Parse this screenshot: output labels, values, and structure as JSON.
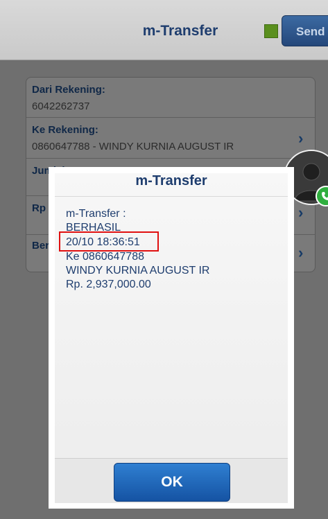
{
  "header": {
    "title": "m-Transfer",
    "send_label": "Send"
  },
  "form": {
    "dari_label": "Dari Rekening:",
    "dari_value": "6042262737",
    "ke_label": "Ke Rekening:",
    "ke_value": "0860647788 - WINDY KURNIA AUGUST IR",
    "jumlah_label": "Jumlah U",
    "rp_label": "Rp",
    "ber_label": "Ber"
  },
  "dialog": {
    "title": "m-Transfer",
    "lines": [
      "m-Transfer :",
      "BERHASIL",
      "20/10 18:36:51",
      "Ke 0860647788",
      "WINDY KURNIA AUGUST IR",
      "Rp. 2,937,000.00"
    ],
    "ok_label": "OK"
  },
  "colors": {
    "accent": "#1e3d6e",
    "highlight": "#e01010",
    "call": "#2fae3e"
  },
  "icons": {
    "status": "status-square-icon",
    "chevron": "chevron-right-icon",
    "avatar": "person-icon",
    "call": "phone-icon"
  }
}
